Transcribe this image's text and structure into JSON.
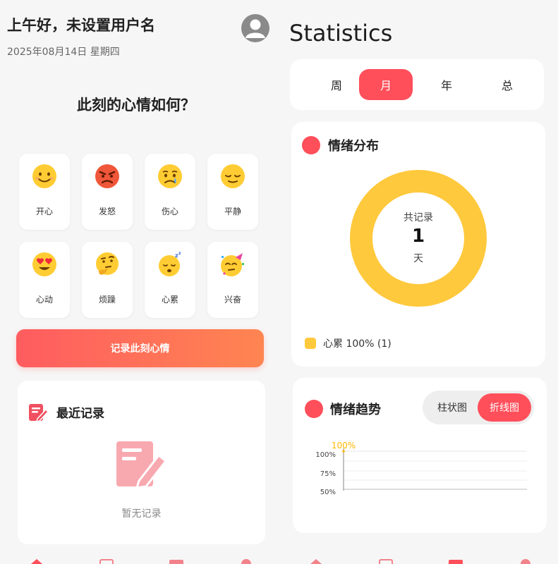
{
  "left_screen": {
    "greeting": "上午好，未设置用户名",
    "date": "2025年08月14日 星期四",
    "question": "此刻的心情如何？",
    "moods": [
      {
        "emoji": "😊",
        "label": "开心"
      },
      {
        "emoji": "😡",
        "label": "发怒"
      },
      {
        "emoji": "😢",
        "label": "伤心"
      },
      {
        "emoji": "😌",
        "label": "平静"
      },
      {
        "emoji": "😍",
        "label": "心动"
      },
      {
        "emoji": "🤔",
        "label": "烦躁"
      },
      {
        "emoji": "😴",
        "label": "心累"
      },
      {
        "emoji": "🥳",
        "label": "兴奋"
      }
    ],
    "record_button": "记录此刻心情",
    "recent_title": "最近记录",
    "empty_text": "暂无记录"
  },
  "right_screen": {
    "title": "Statistics",
    "periods": [
      "周",
      "月",
      "年",
      "总"
    ],
    "active_period": "月",
    "distribution": {
      "title": "情绪分布",
      "center_label": "共记录",
      "center_value": "1",
      "center_unit": "天",
      "legend": [
        {
          "label": "心累 100% (1)",
          "color": "#ffc93d"
        }
      ]
    },
    "trend": {
      "title": "情绪趋势",
      "toggle": [
        "柱状图",
        "折线图"
      ],
      "active_toggle": "折线图",
      "y_ticks": [
        "100%",
        "75%",
        "50%"
      ],
      "point_label": "100%"
    }
  },
  "colors": {
    "accent": "#ff4f5b",
    "gradient_start": "#ff5c60",
    "gradient_end": "#ff8551",
    "donut": "#ffc93d",
    "icon_pink": "#f8a9b0"
  }
}
